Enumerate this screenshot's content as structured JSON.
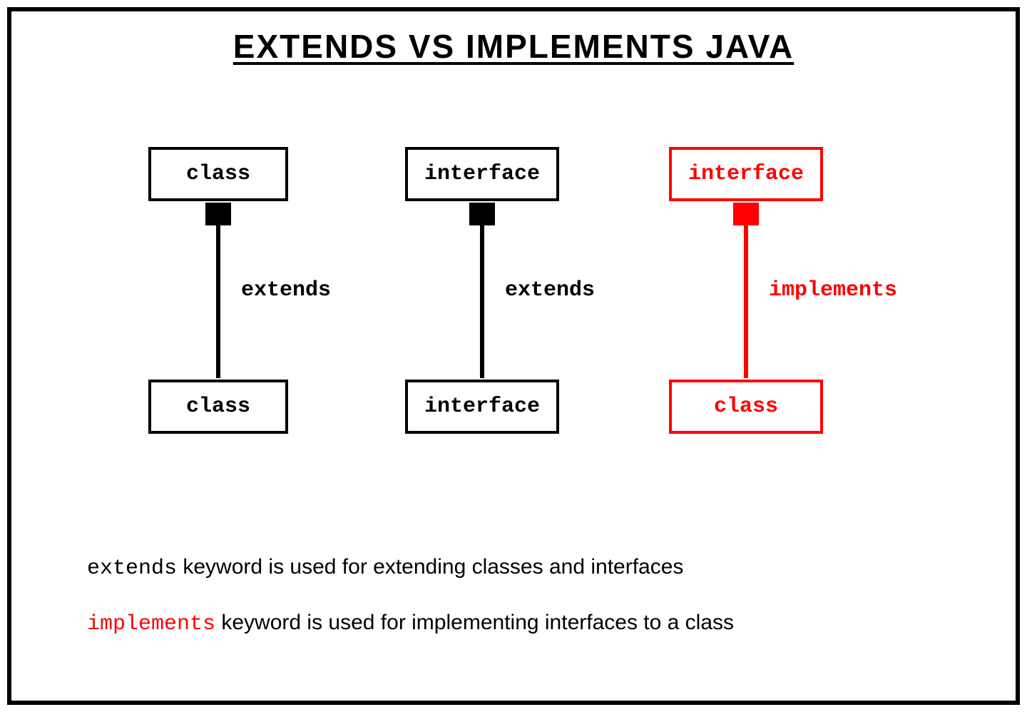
{
  "title": "EXTENDS VS IMPLEMENTS JAVA",
  "columns": [
    {
      "top": "class",
      "bottom": "class",
      "label": "extends",
      "color": "black"
    },
    {
      "top": "interface",
      "bottom": "interface",
      "label": "extends",
      "color": "black"
    },
    {
      "top": "interface",
      "bottom": "class",
      "label": "implements",
      "color": "red"
    }
  ],
  "explanations": [
    {
      "keyword": "extends",
      "keywordColor": "black",
      "rest": " keyword is used for extending classes and interfaces"
    },
    {
      "keyword": "implements",
      "keywordColor": "red",
      "rest": " keyword is used for implementing interfaces to a class"
    }
  ]
}
